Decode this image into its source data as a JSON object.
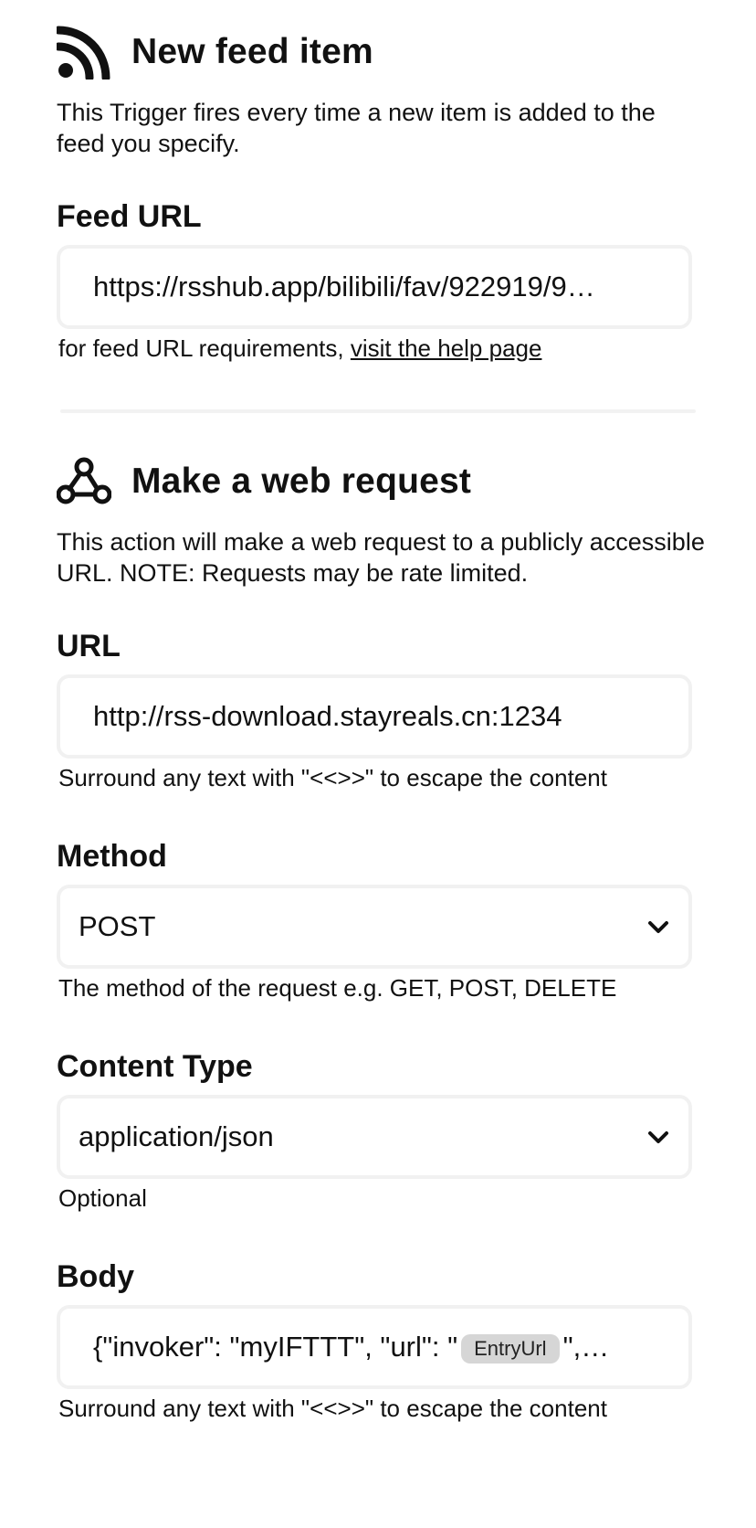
{
  "trigger": {
    "title": "New feed item",
    "icon": "rss-feed-icon",
    "description": "This Trigger fires every time a new item is added to the feed you specify.",
    "feed_url_label": "Feed URL",
    "feed_url_value": "https://rsshub.app/bilibili/fav/922919/9…",
    "help_prefix": "for feed URL requirements, ",
    "help_link": "visit the help page"
  },
  "action": {
    "title": "Make a web request",
    "icon": "webhooks-icon",
    "description": "This action will make a web request to a publicly accessible URL. NOTE: Requests may be rate limited.",
    "url_label": "URL",
    "url_value": "http://rss-download.stayreals.cn:1234",
    "url_helper": "Surround any text with \"<<>>\" to escape the content",
    "method_label": "Method",
    "method_value": "POST",
    "method_helper": "The method of the request e.g. GET, POST, DELETE",
    "content_type_label": "Content Type",
    "content_type_value": "application/json",
    "content_type_helper": "Optional",
    "body_label": "Body",
    "body_prefix": "{\"invoker\": \"myIFTTT\", \"url\": \"",
    "body_ingredient": "EntryUrl",
    "body_suffix": "\",…",
    "body_helper": "Surround any text with \"<<>>\" to escape the content"
  }
}
